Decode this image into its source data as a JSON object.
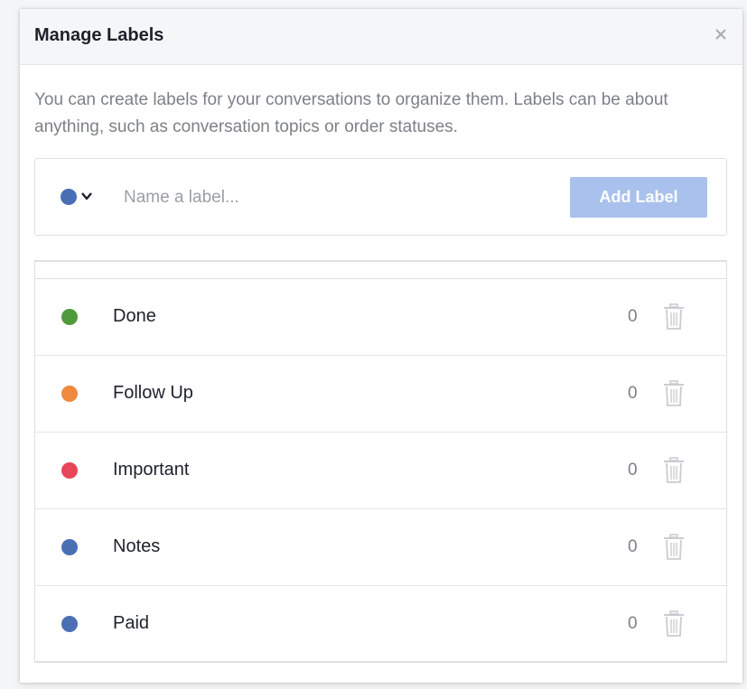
{
  "dialog": {
    "title": "Manage Labels",
    "close_icon": "close-icon",
    "description": "You can create labels for your conversations to organize them. Labels can be about anything, such as conversation topics or order statuses."
  },
  "create": {
    "selected_color": "#4a6fb5",
    "input_placeholder": "Name a label...",
    "input_value": "",
    "add_label": "Add Label",
    "add_button_color": "#a9c1ec"
  },
  "labels": [
    {
      "name": "Done",
      "color": "#4f9a3c",
      "count": "0"
    },
    {
      "name": "Follow Up",
      "color": "#f0883f",
      "count": "0"
    },
    {
      "name": "Important",
      "color": "#e8455a",
      "count": "0"
    },
    {
      "name": "Notes",
      "color": "#4a6fb5",
      "count": "0"
    },
    {
      "name": "Paid",
      "color": "#4a6fb5",
      "count": "0"
    }
  ]
}
